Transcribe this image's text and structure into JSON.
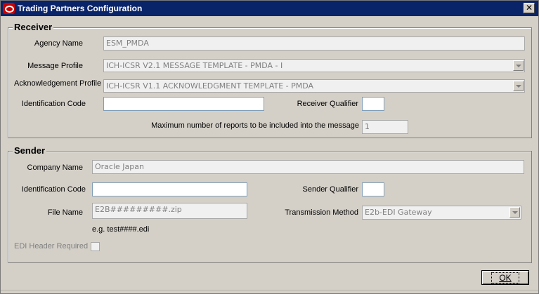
{
  "window": {
    "title": "Trading Partners Configuration",
    "close_glyph": "✕"
  },
  "receiver": {
    "legend": "Receiver",
    "agency_name_label": "Agency Name",
    "agency_name_value": "ESM_PMDA",
    "message_profile_label": "Message Profile",
    "message_profile_value": "ICH-ICSR V2.1 MESSAGE TEMPLATE - PMDA - I",
    "ack_profile_label": "Acknowledgement Profile",
    "ack_profile_value": "ICH-ICSR V1.1 ACKNOWLEDGMENT TEMPLATE - PMDA",
    "identification_code_label": "Identification Code",
    "identification_code_value": "",
    "receiver_qualifier_label": "Receiver Qualifier",
    "receiver_qualifier_value": "",
    "max_reports_label": "Maximum number of reports to be included into the message",
    "max_reports_value": "1"
  },
  "sender": {
    "legend": "Sender",
    "company_name_label": "Company Name",
    "company_name_value": "Oracle Japan",
    "identification_code_label": "Identification Code",
    "identification_code_value": "",
    "sender_qualifier_label": "Sender Qualifier",
    "sender_qualifier_value": "",
    "file_name_label": "File Name",
    "file_name_value": "E2B#########.zip",
    "file_name_example": "e.g.  test####.edi",
    "transmission_method_label": "Transmission Method",
    "transmission_method_value": "E2b-EDI Gateway",
    "edi_header_label": "EDI Header Required",
    "edi_header_checked": false
  },
  "buttons": {
    "ok_label": "OK"
  },
  "icons": {
    "app": "oracle-logo-icon",
    "close": "close-icon",
    "dropdown": "chevron-down-icon"
  }
}
